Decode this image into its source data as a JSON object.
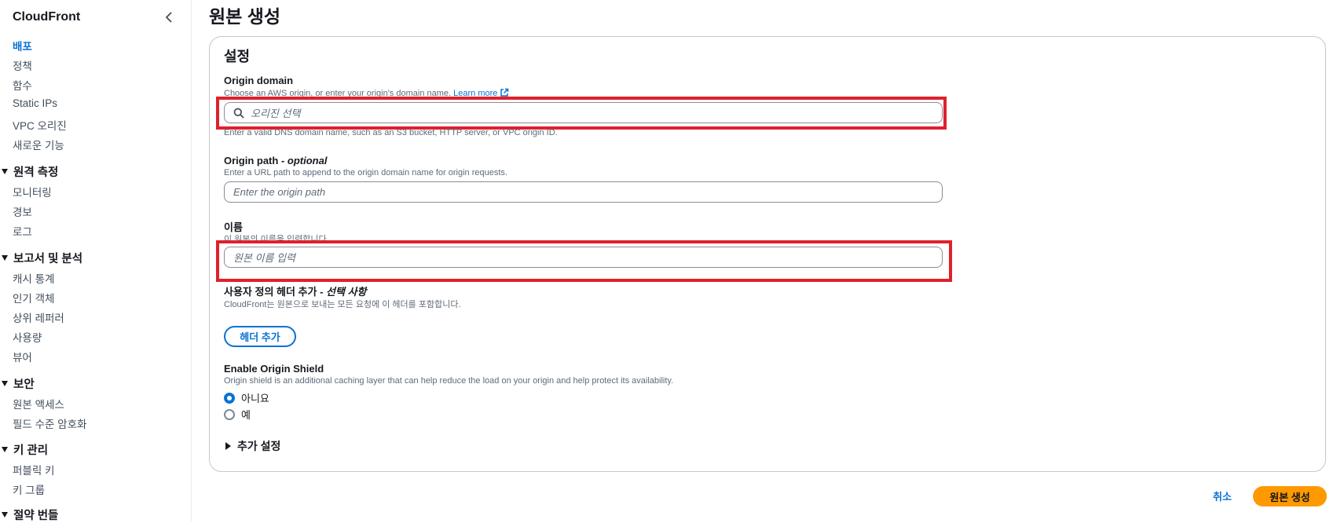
{
  "sidebar": {
    "title": "CloudFront",
    "items_top": [
      "배포",
      "정책",
      "함수",
      "Static IPs",
      "VPC 오리진",
      "새로운 기능"
    ],
    "sections": [
      {
        "title": "원격 측정",
        "items": [
          "모니터링",
          "경보",
          "로그"
        ]
      },
      {
        "title": "보고서 및 분석",
        "items": [
          "캐시 통계",
          "인기 객체",
          "상위 레퍼러",
          "사용량",
          "뷰어"
        ]
      },
      {
        "title": "보안",
        "items": [
          "원본 액세스",
          "필드 수준 암호화"
        ]
      },
      {
        "title": "키 관리",
        "items": [
          "퍼블릭 키",
          "키 그룹"
        ]
      },
      {
        "title": "절약 번들",
        "items": []
      }
    ]
  },
  "page": {
    "title": "원본 생성"
  },
  "form": {
    "section_title": "설정",
    "origin_domain": {
      "label": "Origin domain",
      "description": "Choose an AWS origin, or enter your origin's domain name.",
      "learn_more": "Learn more",
      "placeholder": "오리진 선택",
      "hint": "Enter a valid DNS domain name, such as an S3 bucket, HTTP server, or VPC origin ID."
    },
    "origin_path": {
      "label": "Origin path - ",
      "label_optional": "optional",
      "description": "Enter a URL path to append to the origin domain name for origin requests.",
      "placeholder": "Enter the origin path"
    },
    "name": {
      "label": "이름",
      "description": "이 원본의 이름을 입력합니다.",
      "placeholder": "원본 이름 입력"
    },
    "custom_headers": {
      "label": "사용자 정의 헤더 추가 - ",
      "label_optional": "선택 사항",
      "description": "CloudFront는 원본으로 보내는 모든 요청에 이 헤더를 포함합니다.",
      "button": "헤더 추가"
    },
    "origin_shield": {
      "label": "Enable Origin Shield",
      "description": "Origin shield is an additional caching layer that can help reduce the load on your origin and help protect its availability.",
      "options": [
        "아니요",
        "예"
      ],
      "selected": "아니요"
    },
    "additional_settings": "추가 설정"
  },
  "actions": {
    "cancel": "취소",
    "submit": "원본 생성"
  },
  "colors": {
    "accent": "#0972d3",
    "primary_button": "#ff9900",
    "highlight": "#e0202b"
  }
}
